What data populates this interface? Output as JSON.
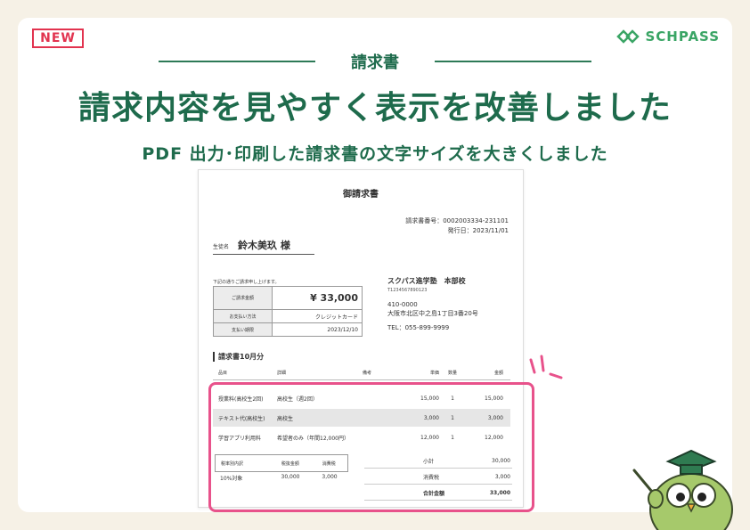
{
  "badge": "NEW",
  "brand": {
    "name": "SCHPASS",
    "icon": "schpass-logo-icon",
    "color": "#3aa565"
  },
  "section_label": "請求書",
  "headline": "請求内容を見やすく表示を改善しました",
  "subline": "PDF 出力･印刷した請求書の文字サイズを大きくしました",
  "colors": {
    "background": "#f6f1e6",
    "headline": "#1e6b4c",
    "accent_pink": "#e8528b",
    "badge_red": "#e2334f"
  },
  "invoice": {
    "title": "御請求書",
    "number": "請求書番号：0002003334-231101",
    "issue_date": "発行日：2023/11/01",
    "student_label": "生徒名",
    "student_name": "鈴木美玖 様",
    "notice": "下記の通りご請求申し上げます。",
    "summary": [
      {
        "label": "ご請求金額",
        "value": "¥ 33,000"
      },
      {
        "label": "お支払い方法",
        "value": "クレジットカード"
      },
      {
        "label": "支払い期限",
        "value": "2023/12/10"
      }
    ],
    "school": {
      "name": "スクパス進学塾　本部校",
      "id": "T1234567890123",
      "postal": "410-0000",
      "address": "大阪市北区中之島1丁目3番20号",
      "tel": "TEL：055-899-9999"
    },
    "section_title": "請求書10月分",
    "columns": [
      "品目",
      "詳細",
      "備考",
      "単価",
      "数量",
      "金額"
    ],
    "items": [
      {
        "name": "授業料(高校生2回)",
        "detail": "高校生（週2回）",
        "note": "",
        "unit": "15,000",
        "qty": "1",
        "amount": "15,000"
      },
      {
        "name": "テキスト代(高校生)",
        "detail": "高校生",
        "note": "",
        "unit": "3,000",
        "qty": "1",
        "amount": "3,000"
      },
      {
        "name": "学習アプリ利用料",
        "detail": "希望者のみ（年間12,000円）",
        "note": "",
        "unit": "12,000",
        "qty": "1",
        "amount": "12,000"
      }
    ],
    "tax_columns": [
      "税率別内訳",
      "税抜金額",
      "消費税"
    ],
    "tax_row": [
      "10%対象",
      "30,000",
      "3,000"
    ],
    "totals": [
      {
        "label": "小計",
        "value": "30,000"
      },
      {
        "label": "消費税",
        "value": "3,000"
      },
      {
        "label": "合計金額",
        "value": "33,000"
      }
    ]
  },
  "mascot_icon": "owl-mascot-icon"
}
